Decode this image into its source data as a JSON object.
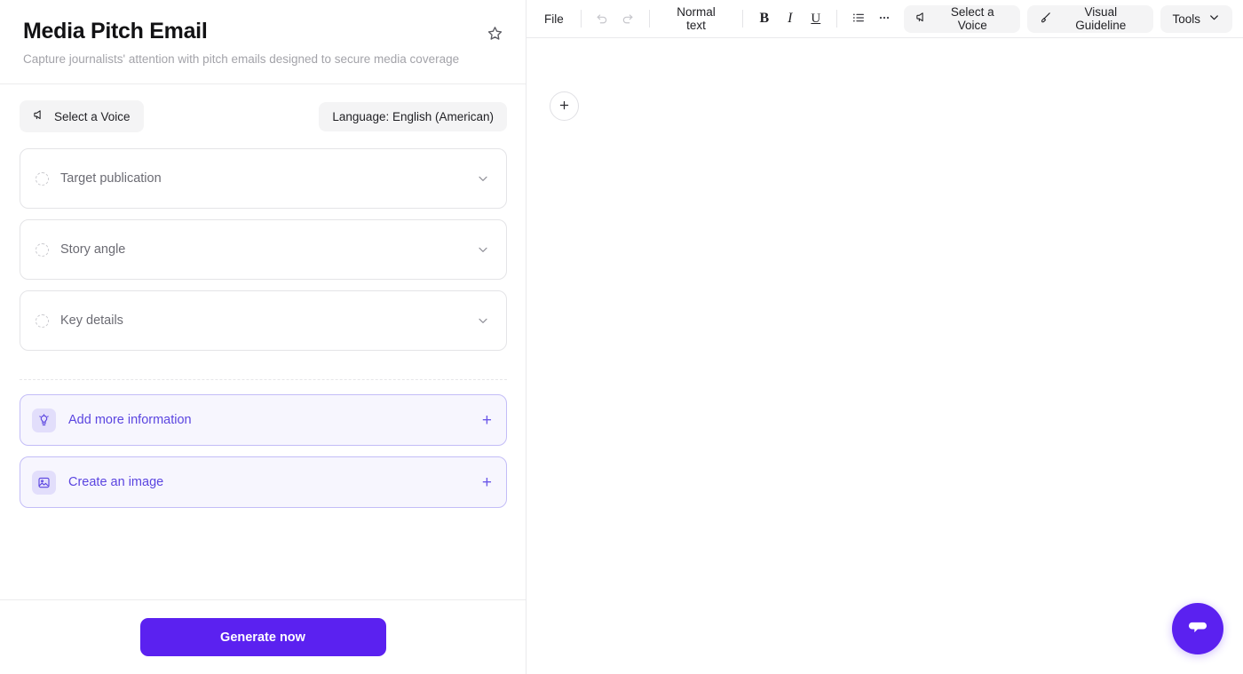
{
  "left_panel": {
    "title": "Media Pitch Email",
    "subtitle": "Capture journalists' attention with pitch emails designed to secure media coverage",
    "favorite_icon": "star-outline-icon",
    "voice_chip": {
      "label": "Select a Voice",
      "icon": "megaphone-icon"
    },
    "language_chip": {
      "label": "Language: English (American)"
    },
    "fields": [
      {
        "label": "Target publication",
        "status_icon": "dashed-circle-icon",
        "expand_icon": "chevron-down-icon"
      },
      {
        "label": "Story angle",
        "status_icon": "dashed-circle-icon",
        "expand_icon": "chevron-down-icon"
      },
      {
        "label": "Key details",
        "status_icon": "dashed-circle-icon",
        "expand_icon": "chevron-down-icon"
      }
    ],
    "actions": [
      {
        "label": "Add more information",
        "icon": "lightbulb-icon",
        "affordance": "+"
      },
      {
        "label": "Create an image",
        "icon": "image-icon",
        "affordance": "+"
      }
    ],
    "generate_button": "Generate now"
  },
  "editor": {
    "toolbar": {
      "file_menu": "File",
      "undo_icon": "undo-icon",
      "redo_icon": "redo-icon",
      "text_style": "Normal text",
      "bold": "B",
      "italic": "I",
      "underline": "U",
      "bullet_list_icon": "bullet-list-icon",
      "more_icon": "more-horizontal-icon",
      "voice_chip": {
        "label": "Select a Voice",
        "icon": "megaphone-icon"
      },
      "visual_guideline_chip": {
        "label": "Visual Guideline",
        "icon": "brush-icon"
      },
      "tools_chip": {
        "label": "Tools",
        "icon": "chevron-down-icon"
      }
    },
    "add_block_icon": "plus-icon",
    "chat_fab_icon": "chat-bubble-icon"
  },
  "colors": {
    "accent": "#5b21f0",
    "action_text": "#5b45e0",
    "action_card_bg": "#f7f6fe",
    "action_card_border": "#c3bdf7",
    "chip_bg": "#f4f4f5"
  }
}
